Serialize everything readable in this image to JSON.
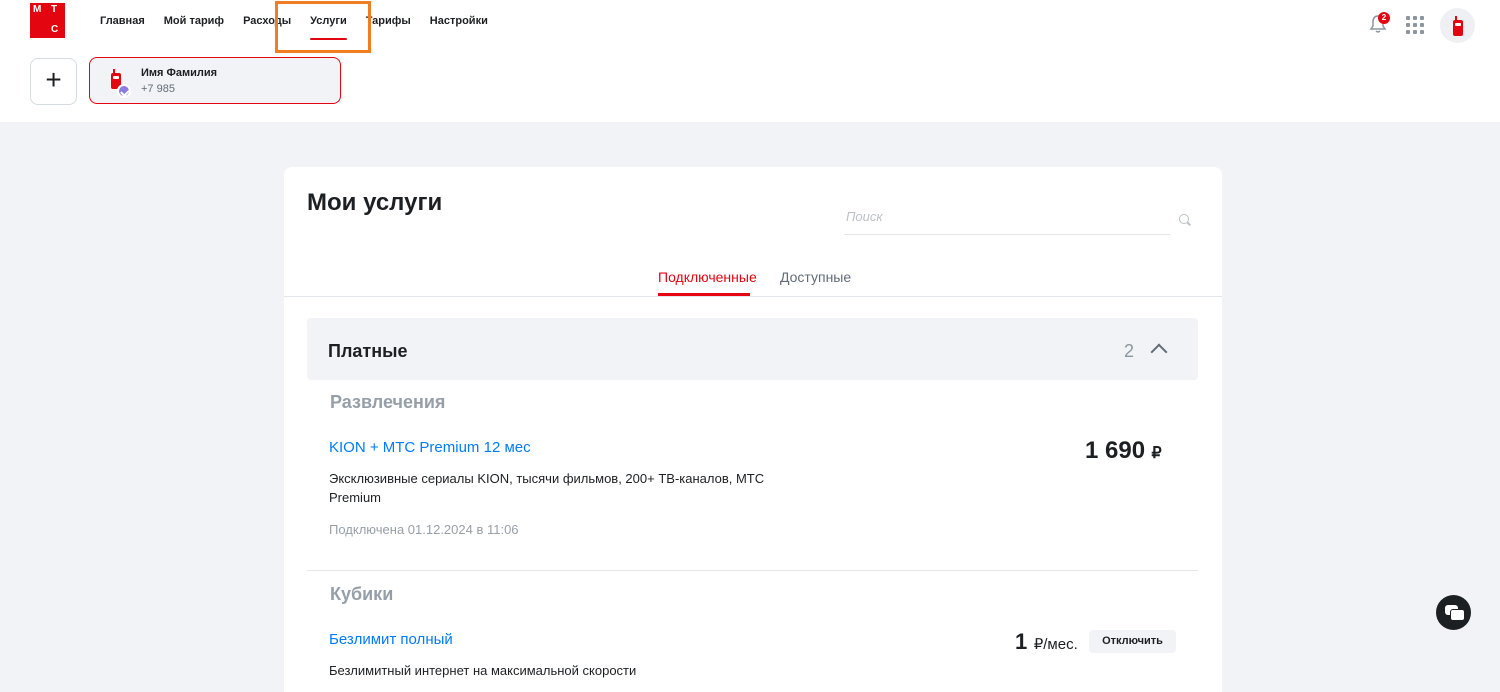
{
  "brand": {
    "logo_letters": [
      "М",
      "Т",
      "С"
    ],
    "accent": "#e30611"
  },
  "nav": [
    {
      "label": "Главная",
      "active": false
    },
    {
      "label": "Мой тариф",
      "active": false
    },
    {
      "label": "Расходы",
      "active": false
    },
    {
      "label": "Услуги",
      "active": true
    },
    {
      "label": "Тарифы",
      "active": false
    },
    {
      "label": "Настройки",
      "active": false
    }
  ],
  "header": {
    "notification_count": "2",
    "apps_icon": "grid-icon",
    "bell_icon": "bell-icon"
  },
  "account": {
    "add_symbol": "+",
    "name": "Имя Фамилия",
    "phone": "+7 985"
  },
  "page": {
    "title": "Мои услуги",
    "search_placeholder": "Поиск",
    "tabs": [
      {
        "label": "Подключенные",
        "active": true
      },
      {
        "label": "Доступные",
        "active": false
      }
    ]
  },
  "group": {
    "title": "Платные",
    "count": "2"
  },
  "services": [
    {
      "category": "Развлечения",
      "name": "KION + МТС Premium 12 мес",
      "description": "Эксклюзивные сериалы KION, тысячи фильмов, 200+ ТВ-каналов, МТС Premium",
      "connected": "Подключена 01.12.2024 в 11:06",
      "price": "1 690",
      "currency": "₽"
    },
    {
      "category": "Кубики",
      "name": "Безлимит полный",
      "description": "Безлимитный интернет на максимальной скорости",
      "price": "1",
      "currency": "₽/мес.",
      "action": "Отключить"
    }
  ]
}
